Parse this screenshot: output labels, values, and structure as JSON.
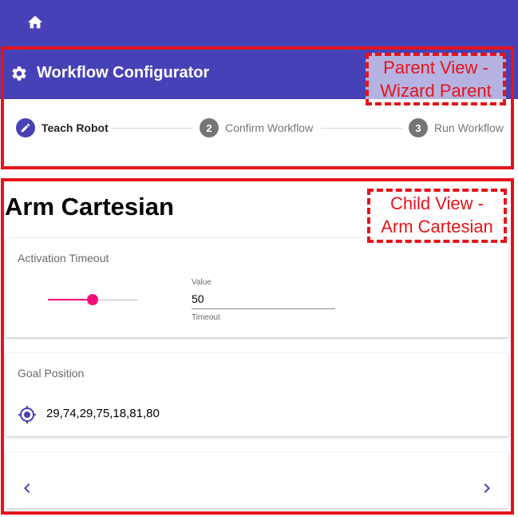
{
  "colors": {
    "primary": "#4741b7",
    "accent": "#f50f7a",
    "annotation": "#e4141b"
  },
  "topbar": {
    "home_icon": "home-icon"
  },
  "parent": {
    "title": "Workflow Configurator",
    "icon": "gear-icon"
  },
  "stepper": {
    "steps": [
      {
        "number": "",
        "label": "Teach Robot",
        "icon": "pencil-icon",
        "state": "active"
      },
      {
        "number": "2",
        "label": "Confirm Workflow",
        "state": "inactive"
      },
      {
        "number": "3",
        "label": "Run Workflow",
        "state": "inactive"
      }
    ]
  },
  "annotations": {
    "parent_label_line1": "Parent View -",
    "parent_label_line2": "Wizard Parent",
    "child_label_line1": "Child View -",
    "child_label_line2": "Arm Cartesian"
  },
  "child": {
    "title": "Arm Cartesian",
    "activation": {
      "title": "Activation Timeout",
      "slider_level": 0.5,
      "value_label": "Value",
      "value": "50",
      "helper": "Timeout"
    },
    "goal": {
      "title": "Goal Position",
      "icon": "crosshair-icon",
      "value": "29,74,29,75,18,81,80"
    },
    "nav": {
      "prev_icon": "chevron-left-icon",
      "next_icon": "chevron-right-icon"
    }
  }
}
